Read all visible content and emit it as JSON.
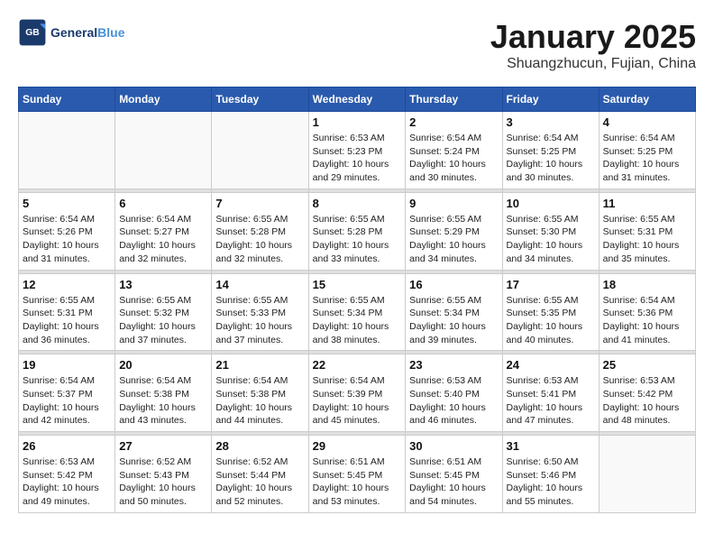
{
  "header": {
    "logo_general": "General",
    "logo_blue": "Blue",
    "month_title": "January 2025",
    "subtitle": "Shuangzhucun, Fujian, China"
  },
  "weekdays": [
    "Sunday",
    "Monday",
    "Tuesday",
    "Wednesday",
    "Thursday",
    "Friday",
    "Saturday"
  ],
  "weeks": [
    [
      {
        "day": "",
        "info": ""
      },
      {
        "day": "",
        "info": ""
      },
      {
        "day": "",
        "info": ""
      },
      {
        "day": "1",
        "info": "Sunrise: 6:53 AM\nSunset: 5:23 PM\nDaylight: 10 hours\nand 29 minutes."
      },
      {
        "day": "2",
        "info": "Sunrise: 6:54 AM\nSunset: 5:24 PM\nDaylight: 10 hours\nand 30 minutes."
      },
      {
        "day": "3",
        "info": "Sunrise: 6:54 AM\nSunset: 5:25 PM\nDaylight: 10 hours\nand 30 minutes."
      },
      {
        "day": "4",
        "info": "Sunrise: 6:54 AM\nSunset: 5:25 PM\nDaylight: 10 hours\nand 31 minutes."
      }
    ],
    [
      {
        "day": "5",
        "info": "Sunrise: 6:54 AM\nSunset: 5:26 PM\nDaylight: 10 hours\nand 31 minutes."
      },
      {
        "day": "6",
        "info": "Sunrise: 6:54 AM\nSunset: 5:27 PM\nDaylight: 10 hours\nand 32 minutes."
      },
      {
        "day": "7",
        "info": "Sunrise: 6:55 AM\nSunset: 5:28 PM\nDaylight: 10 hours\nand 32 minutes."
      },
      {
        "day": "8",
        "info": "Sunrise: 6:55 AM\nSunset: 5:28 PM\nDaylight: 10 hours\nand 33 minutes."
      },
      {
        "day": "9",
        "info": "Sunrise: 6:55 AM\nSunset: 5:29 PM\nDaylight: 10 hours\nand 34 minutes."
      },
      {
        "day": "10",
        "info": "Sunrise: 6:55 AM\nSunset: 5:30 PM\nDaylight: 10 hours\nand 34 minutes."
      },
      {
        "day": "11",
        "info": "Sunrise: 6:55 AM\nSunset: 5:31 PM\nDaylight: 10 hours\nand 35 minutes."
      }
    ],
    [
      {
        "day": "12",
        "info": "Sunrise: 6:55 AM\nSunset: 5:31 PM\nDaylight: 10 hours\nand 36 minutes."
      },
      {
        "day": "13",
        "info": "Sunrise: 6:55 AM\nSunset: 5:32 PM\nDaylight: 10 hours\nand 37 minutes."
      },
      {
        "day": "14",
        "info": "Sunrise: 6:55 AM\nSunset: 5:33 PM\nDaylight: 10 hours\nand 37 minutes."
      },
      {
        "day": "15",
        "info": "Sunrise: 6:55 AM\nSunset: 5:34 PM\nDaylight: 10 hours\nand 38 minutes."
      },
      {
        "day": "16",
        "info": "Sunrise: 6:55 AM\nSunset: 5:34 PM\nDaylight: 10 hours\nand 39 minutes."
      },
      {
        "day": "17",
        "info": "Sunrise: 6:55 AM\nSunset: 5:35 PM\nDaylight: 10 hours\nand 40 minutes."
      },
      {
        "day": "18",
        "info": "Sunrise: 6:54 AM\nSunset: 5:36 PM\nDaylight: 10 hours\nand 41 minutes."
      }
    ],
    [
      {
        "day": "19",
        "info": "Sunrise: 6:54 AM\nSunset: 5:37 PM\nDaylight: 10 hours\nand 42 minutes."
      },
      {
        "day": "20",
        "info": "Sunrise: 6:54 AM\nSunset: 5:38 PM\nDaylight: 10 hours\nand 43 minutes."
      },
      {
        "day": "21",
        "info": "Sunrise: 6:54 AM\nSunset: 5:38 PM\nDaylight: 10 hours\nand 44 minutes."
      },
      {
        "day": "22",
        "info": "Sunrise: 6:54 AM\nSunset: 5:39 PM\nDaylight: 10 hours\nand 45 minutes."
      },
      {
        "day": "23",
        "info": "Sunrise: 6:53 AM\nSunset: 5:40 PM\nDaylight: 10 hours\nand 46 minutes."
      },
      {
        "day": "24",
        "info": "Sunrise: 6:53 AM\nSunset: 5:41 PM\nDaylight: 10 hours\nand 47 minutes."
      },
      {
        "day": "25",
        "info": "Sunrise: 6:53 AM\nSunset: 5:42 PM\nDaylight: 10 hours\nand 48 minutes."
      }
    ],
    [
      {
        "day": "26",
        "info": "Sunrise: 6:53 AM\nSunset: 5:42 PM\nDaylight: 10 hours\nand 49 minutes."
      },
      {
        "day": "27",
        "info": "Sunrise: 6:52 AM\nSunset: 5:43 PM\nDaylight: 10 hours\nand 50 minutes."
      },
      {
        "day": "28",
        "info": "Sunrise: 6:52 AM\nSunset: 5:44 PM\nDaylight: 10 hours\nand 52 minutes."
      },
      {
        "day": "29",
        "info": "Sunrise: 6:51 AM\nSunset: 5:45 PM\nDaylight: 10 hours\nand 53 minutes."
      },
      {
        "day": "30",
        "info": "Sunrise: 6:51 AM\nSunset: 5:45 PM\nDaylight: 10 hours\nand 54 minutes."
      },
      {
        "day": "31",
        "info": "Sunrise: 6:50 AM\nSunset: 5:46 PM\nDaylight: 10 hours\nand 55 minutes."
      },
      {
        "day": "",
        "info": ""
      }
    ]
  ]
}
